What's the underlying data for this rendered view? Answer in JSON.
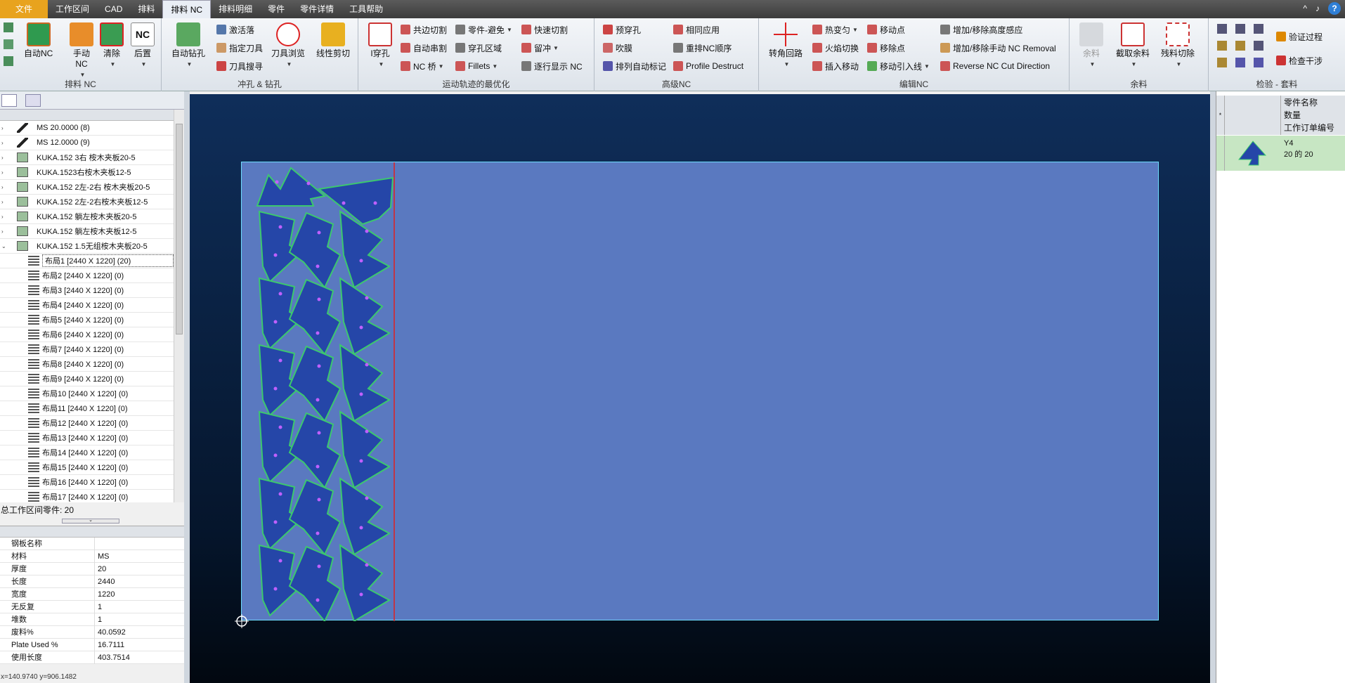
{
  "menu": {
    "file": "文件",
    "items": [
      "工作区间",
      "CAD",
      "排料",
      "排料 NC",
      "排料明细",
      "零件",
      "零件详情",
      "工具帮助"
    ],
    "active_index": 3
  },
  "window": {
    "min": "^",
    "restore": "♪",
    "help": "?"
  },
  "ribbon": {
    "g1": {
      "label": "排料 NC",
      "auto_nc": "自动NC",
      "manual_nc": "手动 NC",
      "clear": "清除",
      "post": "后置"
    },
    "g2": {
      "label": "冲孔 & 钻孔",
      "auto_drill": "自动钻孔",
      "activate": "激活落",
      "assign_tool": "指定刀具",
      "search_tool": "刀具搜寻",
      "browse_tool": "刀具浏览",
      "line_shear": "线性剪切"
    },
    "g3": {
      "label": "运动轨迹的最优化",
      "pierce": "I穿孔",
      "common_cut": "共边切割",
      "auto_chain": "自动串割",
      "nc_bridge": "NC 桥",
      "part_avoid": "零件-避免",
      "pierce_zone": "穿孔区域",
      "fillets": "Fillets",
      "fast_cut": "快速切割",
      "micro_joint": "留冲",
      "line_display": "逐行显示 NC"
    },
    "g4": {
      "label": "高级NC",
      "pre_pierce": "预穿孔",
      "blow": "吹膜",
      "auto_mark": "排列自动标记",
      "same_apply": "相同应用",
      "resort": "重排NC顺序",
      "profile_destruct": "Profile Destruct"
    },
    "g5": {
      "label": "编辑NC",
      "corner_loop": "转角回路",
      "heat": "热变匀",
      "flame_switch": "火焰切换",
      "insert_move": "插入移动",
      "move_point": "移动点",
      "remove_point": "移除点",
      "move_lead": "移动引入线",
      "add_height": "增加/移除高度感应",
      "add_manual": "增加/移除手动 NC Removal",
      "reverse": "Reverse NC Cut Direction"
    },
    "g6": {
      "label": "余料",
      "remnant": "余料",
      "cut_remnant": "截取余料",
      "scrap_cut": "残料切除"
    },
    "g7": {
      "label": "检验 - 套料",
      "verify": "验证过程",
      "check_interference": "检查干涉"
    }
  },
  "tree": {
    "rows": [
      {
        "label": "MS 20.0000 (8)",
        "type": "material"
      },
      {
        "label": "MS 12.0000 (9)",
        "type": "material"
      },
      {
        "label": "KUKA.152 3右 桉木夹板20-5",
        "type": "part"
      },
      {
        "label": "KUKA.1523右桉木夹板12-5",
        "type": "part"
      },
      {
        "label": "KUKA.152 2左-2右 桉木夹板20-5",
        "type": "part"
      },
      {
        "label": "KUKA.152  2左-2右桉木夹板12-5",
        "type": "part"
      },
      {
        "label": "KUKA.152  躺左桉木夹板20-5",
        "type": "part"
      },
      {
        "label": "KUKA.152  躺左桉木夹板12-5",
        "type": "part"
      },
      {
        "label": "KUKA.152  1.5无组桉木夹板20-5",
        "type": "part",
        "expanded": true
      }
    ],
    "layouts": [
      "布局1 [2440 X 1220]  (20)",
      "布局2 [2440 X 1220]  (0)",
      "布局3 [2440 X 1220]  (0)",
      "布局4 [2440 X 1220]  (0)",
      "布局5 [2440 X 1220]  (0)",
      "布局6 [2440 X 1220]  (0)",
      "布局7 [2440 X 1220]  (0)",
      "布局8 [2440 X 1220]  (0)",
      "布局9 [2440 X 1220]  (0)",
      "布局10 [2440 X 1220]  (0)",
      "布局11 [2440 X 1220]  (0)",
      "布局12 [2440 X 1220]  (0)",
      "布局13 [2440 X 1220]  (0)",
      "布局14 [2440 X 1220]  (0)",
      "布局15 [2440 X 1220]  (0)",
      "布局16 [2440 X 1220]  (0)",
      "布局17 [2440 X 1220]  (0)"
    ]
  },
  "total": "总工作区间零件: 20",
  "props": [
    {
      "k": "钢板名称",
      "v": ""
    },
    {
      "k": "材料",
      "v": "MS"
    },
    {
      "k": "厚度",
      "v": "20"
    },
    {
      "k": "长度",
      "v": "2440"
    },
    {
      "k": "宽度",
      "v": "1220"
    },
    {
      "k": "无反复",
      "v": "1"
    },
    {
      "k": "堆数",
      "v": "1"
    },
    {
      "k": "废料%",
      "v": "40.0592"
    },
    {
      "k": "Plate Used %",
      "v": "16.7111"
    },
    {
      "k": "使用长度",
      "v": "403.7514"
    }
  ],
  "status": "x=140.9740  y=906.1482",
  "right": {
    "h1": "零件名称",
    "h2": "数量",
    "h3": "工作订单编号",
    "name": "Y4",
    "qty": "20 的 20"
  },
  "colors": {
    "plate": "#5a79c0",
    "part": "#2546a8",
    "part_edge": "#3cc86e",
    "cutline": "#e02020"
  }
}
